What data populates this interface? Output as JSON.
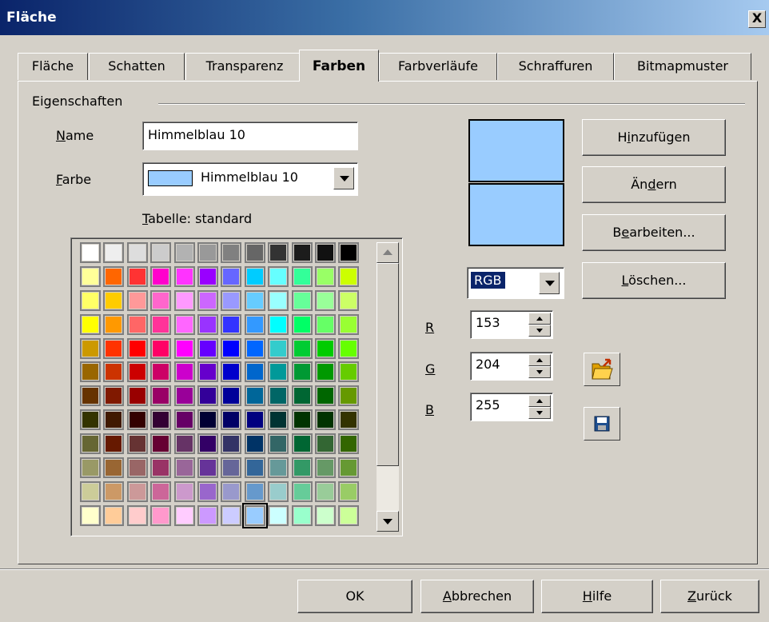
{
  "window": {
    "title": "Fläche",
    "close_glyph": "X"
  },
  "tabs": [
    {
      "label": "Fläche",
      "active": false
    },
    {
      "label": "Schatten",
      "active": false
    },
    {
      "label": "Transparenz",
      "active": false
    },
    {
      "label": "Farben",
      "active": true
    },
    {
      "label": "Farbverläufe",
      "active": false
    },
    {
      "label": "Schraffuren",
      "active": false
    },
    {
      "label": "Bitmapmuster",
      "active": false
    }
  ],
  "properties": {
    "group_label": "Eigenschaften",
    "name_label": {
      "first": "N",
      "rest": "ame"
    },
    "name_value": "Himmelblau 10",
    "color_label": {
      "first": "F",
      "rest": "arbe"
    },
    "color_value": "Himmelblau 10",
    "color_swatch": "#99ccff",
    "table_label": {
      "first": "T",
      "rest": "abelle: standard"
    }
  },
  "palette": {
    "rows": [
      [
        "#ffffff",
        "#eeeeee",
        "#dddddd",
        "#cccccc",
        "#b2b2b2",
        "#999999",
        "#808080",
        "#666666",
        "#333333",
        "#1c1c1c",
        "#111111",
        "#000000"
      ],
      [
        "#ffff99",
        "#ff6600",
        "#ff3333",
        "#ff00cc",
        "#ff33ff",
        "#9900ff",
        "#6666ff",
        "#00ccff",
        "#66ffff",
        "#33ff99",
        "#99ff66",
        "#ccff00"
      ],
      [
        "#ffff66",
        "#ffcc00",
        "#ff9999",
        "#ff66cc",
        "#ff99ff",
        "#cc66ff",
        "#9999ff",
        "#66ccff",
        "#99ffff",
        "#66ff99",
        "#99ff99",
        "#ccff66"
      ],
      [
        "#ffff00",
        "#ff9900",
        "#ff6666",
        "#ff3399",
        "#ff66ff",
        "#9933ff",
        "#3333ff",
        "#3399ff",
        "#00ffff",
        "#00ff66",
        "#66ff66",
        "#99ff33"
      ],
      [
        "#cc9900",
        "#ff3300",
        "#ff0000",
        "#ff0066",
        "#ff00ff",
        "#6600ff",
        "#0000ff",
        "#0066ff",
        "#33cccc",
        "#00cc33",
        "#00cc00",
        "#66ff00"
      ],
      [
        "#996600",
        "#cc3300",
        "#cc0000",
        "#cc0066",
        "#cc00cc",
        "#6600cc",
        "#0000cc",
        "#0066cc",
        "#009999",
        "#009933",
        "#009900",
        "#66cc00"
      ],
      [
        "#663300",
        "#801900",
        "#990000",
        "#990066",
        "#990099",
        "#330099",
        "#000099",
        "#006699",
        "#006666",
        "#006633",
        "#006600",
        "#669900"
      ],
      [
        "#333300",
        "#401900",
        "#330000",
        "#330033",
        "#660066",
        "#000033",
        "#000066",
        "#000080",
        "#003333",
        "#003300",
        "#003300",
        "#333300"
      ],
      [
        "#666633",
        "#661900",
        "#663333",
        "#660033",
        "#663366",
        "#330066",
        "#333366",
        "#003366",
        "#336666",
        "#006633",
        "#336633",
        "#336600"
      ],
      [
        "#999966",
        "#996633",
        "#996666",
        "#993366",
        "#996699",
        "#663399",
        "#666699",
        "#336699",
        "#669999",
        "#339966",
        "#669966",
        "#669933"
      ],
      [
        "#cccc99",
        "#cc9966",
        "#cc9999",
        "#cc6699",
        "#cc99cc",
        "#9966cc",
        "#9999cc",
        "#6699cc",
        "#99cccc",
        "#66cc99",
        "#99cc99",
        "#99cc66"
      ],
      [
        "#ffffcc",
        "#ffcc99",
        "#ffcccc",
        "#ff99cc",
        "#ffccff",
        "#cc99ff",
        "#ccccff",
        "#99ccff",
        "#ccffff",
        "#99ffcc",
        "#ccffcc",
        "#ccff99"
      ]
    ],
    "selected_row": 11,
    "selected_col": 7
  },
  "preview": {
    "top_color": "#99ccff",
    "bottom_color": "#99ccff"
  },
  "color_model": {
    "value": "RGB"
  },
  "rgb": {
    "r_label": "R",
    "r_value": "153",
    "g_label": "G",
    "g_value": "204",
    "b_label": "B",
    "b_value": "255"
  },
  "buttons": {
    "add": {
      "pre": "H",
      "u": "i",
      "post": "nzufügen"
    },
    "modify": {
      "pre": "Än",
      "u": "d",
      "post": "ern"
    },
    "edit": {
      "pre": "B",
      "u": "e",
      "post": "arbeiten..."
    },
    "delete": {
      "pre": "",
      "u": "L",
      "post": "öschen..."
    }
  },
  "icons": {
    "open": "open-folder-icon",
    "save": "save-disk-icon"
  },
  "footer": {
    "ok": "OK",
    "cancel": {
      "u": "A",
      "post": "bbrechen"
    },
    "help": {
      "u": "H",
      "post": "ilfe"
    },
    "back": {
      "u": "Z",
      "post": "urück"
    }
  }
}
